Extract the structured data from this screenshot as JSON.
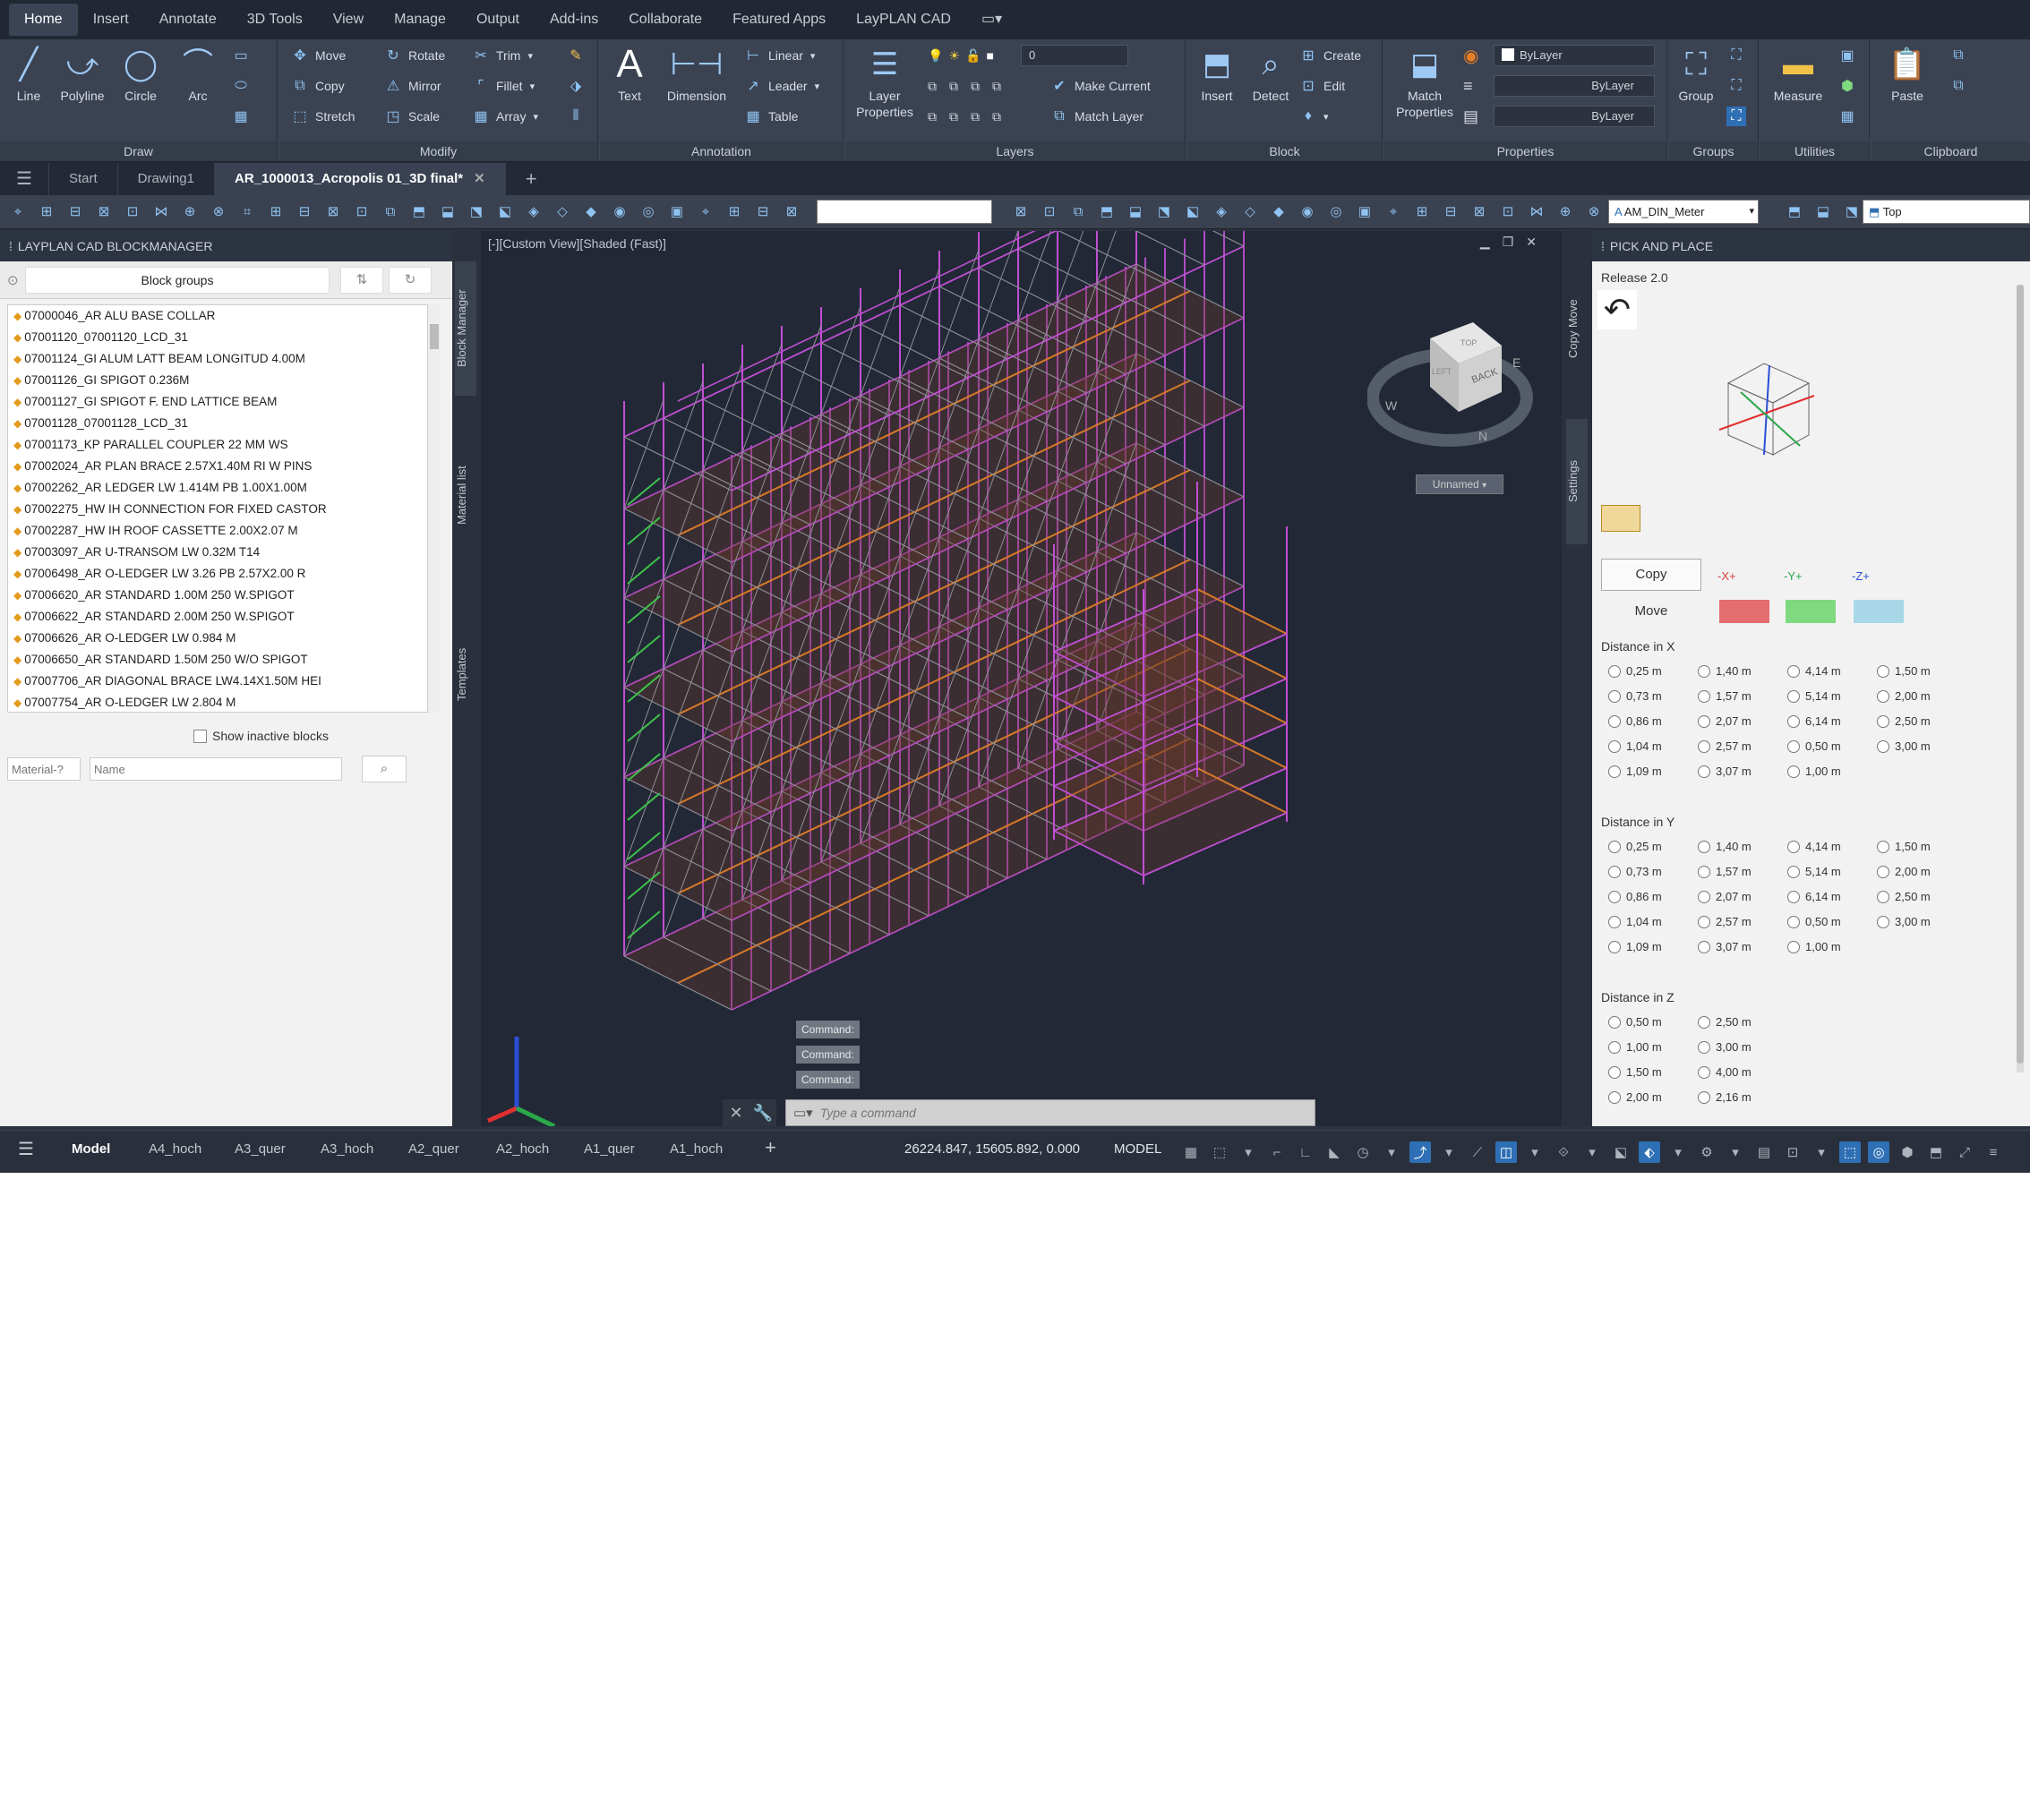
{
  "menu": [
    "Home",
    "Insert",
    "Annotate",
    "3D Tools",
    "View",
    "Manage",
    "Output",
    "Add-ins",
    "Collaborate",
    "Featured Apps",
    "LayPLAN CAD"
  ],
  "ribbon": {
    "draw": {
      "title": "Draw",
      "line": "Line",
      "polyline": "Polyline",
      "circle": "Circle",
      "arc": "Arc"
    },
    "modify": {
      "title": "Modify",
      "move": "Move",
      "rotate": "Rotate",
      "trim": "Trim",
      "copy": "Copy",
      "mirror": "Mirror",
      "fillet": "Fillet",
      "stretch": "Stretch",
      "scale": "Scale",
      "array": "Array"
    },
    "annotation": {
      "title": "Annotation",
      "text": "Text",
      "dimension": "Dimension",
      "linear": "Linear",
      "leader": "Leader",
      "table": "Table"
    },
    "layers": {
      "title": "Layers",
      "layer_properties": "Layer Properties",
      "layer_value": "0",
      "make_current": "Make Current",
      "match_layer": "Match Layer"
    },
    "block": {
      "title": "Block",
      "insert": "Insert",
      "detect": "Detect",
      "create": "Create",
      "edit": "Edit"
    },
    "properties": {
      "title": "Properties",
      "match_properties": "Match Properties",
      "bylayer1": "ByLayer",
      "bylayer2": "ByLayer",
      "bylayer3": "ByLayer"
    },
    "groups": {
      "title": "Groups",
      "group": "Group"
    },
    "utilities": {
      "title": "Utilities",
      "measure": "Measure"
    },
    "clipboard": {
      "title": "Clipboard",
      "paste": "Paste"
    }
  },
  "file_tabs": [
    "Start",
    "Drawing1",
    "AR_1000013_Acropolis 01_3D final*"
  ],
  "toolbar": {
    "dim_style": "AM_DIN_Meter",
    "view": "Top"
  },
  "left_panel": {
    "title": "LAYPLAN CAD BLOCKMANAGER",
    "block_groups": "Block groups",
    "show_inactive": "Show inactive blocks",
    "material_placeholder": "Material-?",
    "name_placeholder": "Name",
    "blocks": [
      "07000046_AR ALU BASE COLLAR",
      "07001120_07001120_LCD_31",
      "07001124_GI ALUM LATT BEAM LONGITUD 4.00M",
      "07001126_GI SPIGOT 0.236M",
      "07001127_GI SPIGOT F. END LATTICE BEAM",
      "07001128_07001128_LCD_31",
      "07001173_KP PARALLEL COUPLER 22 MM WS",
      "07002024_AR PLAN BRACE 2.57X1.40M RI W PINS",
      "07002262_AR LEDGER LW 1.414M PB 1.00X1.00M",
      "07002275_HW IH CONNECTION FOR FIXED CASTOR",
      "07002287_HW IH ROOF CASSETTE 2.00X2.07 M",
      "07003097_AR U-TRANSOM LW 0.32M T14",
      "07006498_AR O-LEDGER LW 3.26 PB 2.57X2.00 R",
      "07006620_AR STANDARD 1.00M 250 W.SPIGOT",
      "07006622_AR STANDARD 2.00M 250 W.SPIGOT",
      "07006626_AR O-LEDGER LW 0.984 M",
      "07006650_AR STANDARD 1.50M 250 W/O SPIGOT",
      "07007706_AR DIAGONAL BRACE LW4.14X1.50M HEI",
      "07007754_AR O-LEDGER LW 2.804 M"
    ],
    "side_tabs": [
      "Block Manager",
      "Material list",
      "Templates"
    ]
  },
  "viewport": {
    "label": "[-][Custom View][Shaded (Fast)]",
    "cube_face": "BACK",
    "cube_top": "TOP",
    "cube_left": "LEFT",
    "unnamed": "Unnamed",
    "compass_w": "W",
    "compass_n": "N",
    "compass_e": "E",
    "commands": [
      "Command:",
      "Command:",
      "Command:"
    ],
    "command_placeholder": "Type a command"
  },
  "right_panel": {
    "title": "PICK AND PLACE",
    "release": "Release 2.0",
    "side_tabs": [
      "Copy Move",
      "Settings"
    ],
    "copy": "Copy",
    "move": "Move",
    "axis_x": "-X+",
    "axis_y": "-Y+",
    "axis_z": "-Z+",
    "colors": {
      "x": "#e36d6f",
      "y": "#7fd97f",
      "z": "#a8d8e8"
    },
    "dist_x_label": "Distance in X",
    "dist_y_label": "Distance in Y",
    "dist_z_label": "Distance in Z",
    "dist_xy_values": [
      "0,25 m",
      "1,40 m",
      "4,14 m",
      "1,50 m",
      "0,73 m",
      "1,57 m",
      "5,14 m",
      "2,00 m",
      "0,86 m",
      "2,07 m",
      "6,14 m",
      "2,50 m",
      "1,04 m",
      "2,57 m",
      "0,50 m",
      "3,00 m",
      "1,09 m",
      "3,07 m",
      "1,00 m"
    ],
    "dist_z_values": [
      "0,50 m",
      "2,50 m",
      "1,00 m",
      "3,00 m",
      "1,50 m",
      "4,00 m",
      "2,00 m",
      "2,16 m"
    ]
  },
  "status": {
    "tabs": [
      "Model",
      "A4_hoch",
      "A3_quer",
      "A3_hoch",
      "A2_quer",
      "A2_hoch",
      "A1_quer",
      "A1_hoch"
    ],
    "coords": "26224.847, 15605.892, 0.000",
    "mode": "MODEL"
  }
}
